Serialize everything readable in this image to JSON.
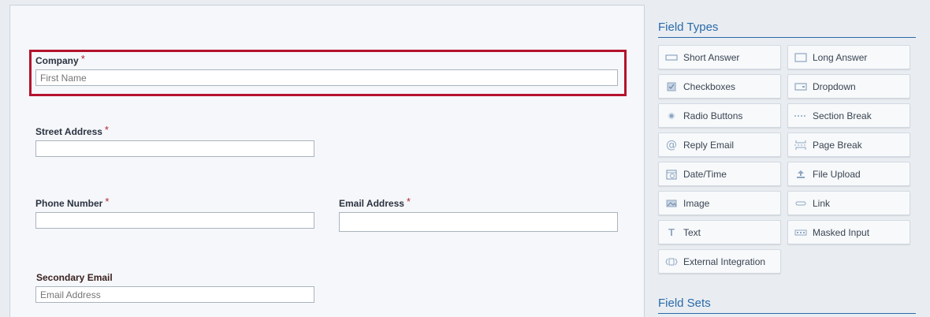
{
  "form": {
    "company": {
      "label": "Company",
      "required": "*",
      "placeholder": "First Name"
    },
    "street_address": {
      "label": "Street Address",
      "required": "*",
      "value": ""
    },
    "phone_number": {
      "label": "Phone Number",
      "required": "*",
      "value": ""
    },
    "email_address": {
      "label": "Email Address",
      "required": "*",
      "value": ""
    },
    "secondary_email": {
      "label": "Secondary Email",
      "placeholder": "Email Address"
    }
  },
  "sidebar": {
    "field_types_title": "Field Types",
    "field_sets_title": "Field Sets",
    "field_types": [
      {
        "label": "Short Answer",
        "icon": "short-answer-icon"
      },
      {
        "label": "Long Answer",
        "icon": "long-answer-icon"
      },
      {
        "label": "Checkboxes",
        "icon": "checkbox-icon"
      },
      {
        "label": "Dropdown",
        "icon": "dropdown-icon"
      },
      {
        "label": "Radio Buttons",
        "icon": "radio-icon"
      },
      {
        "label": "Section Break",
        "icon": "section-break-icon"
      },
      {
        "label": "Reply Email",
        "icon": "at-sign-icon"
      },
      {
        "label": "Page Break",
        "icon": "page-break-icon"
      },
      {
        "label": "Date/Time",
        "icon": "calendar-icon"
      },
      {
        "label": "File Upload",
        "icon": "upload-icon"
      },
      {
        "label": "Image",
        "icon": "image-icon"
      },
      {
        "label": "Link",
        "icon": "link-icon"
      },
      {
        "label": "Text",
        "icon": "text-icon"
      },
      {
        "label": "Masked Input",
        "icon": "masked-input-icon"
      },
      {
        "label": "External Integration",
        "icon": "integration-icon"
      }
    ]
  },
  "colors": {
    "accent": "#2a6aa8",
    "required": "#b32635",
    "selection": "#b4122c"
  }
}
